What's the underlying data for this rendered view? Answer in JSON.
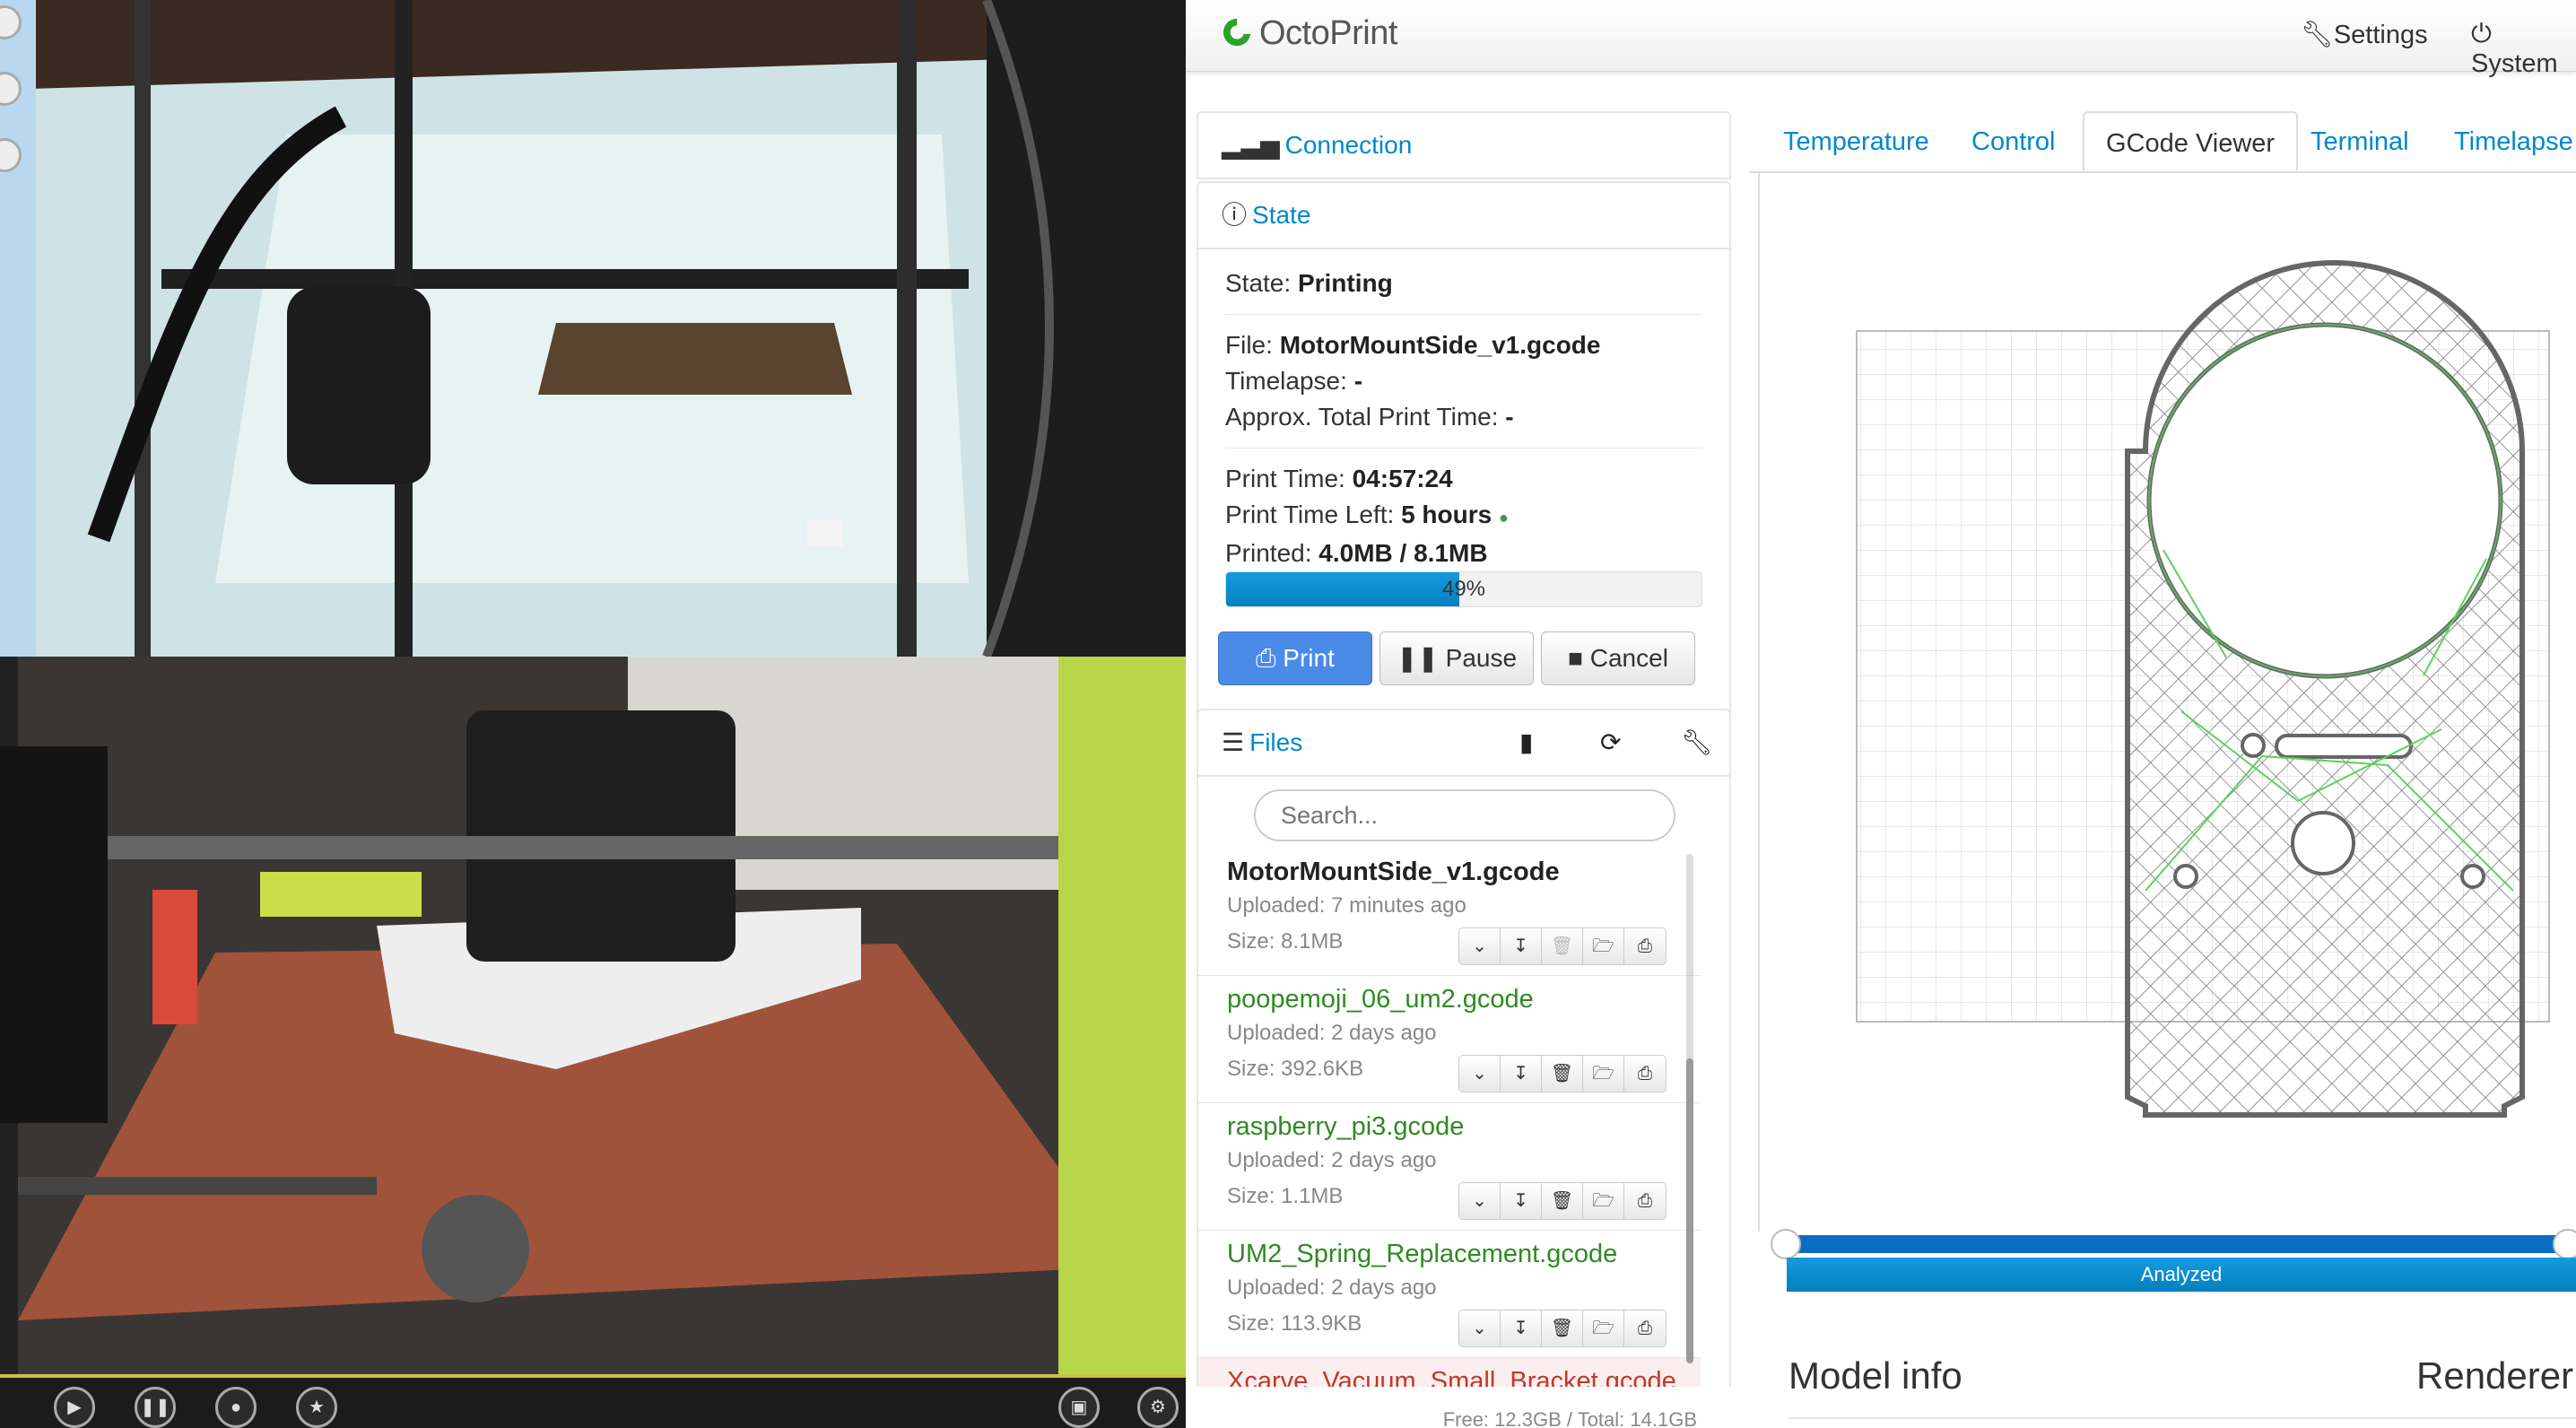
{
  "app": {
    "brand": "OctoPrint"
  },
  "navbar": {
    "settings_label": "Settings",
    "system_label": "System"
  },
  "sidebar": {
    "connection_label": "Connection",
    "state_label": "State",
    "state": {
      "state_label": "State:",
      "state_value": "Printing",
      "file_label": "File:",
      "file_value": "MotorMountSide_v1.gcode",
      "timelapse_label": "Timelapse:",
      "timelapse_value": "-",
      "approx_label": "Approx. Total Print Time:",
      "approx_value": "-",
      "print_time_label": "Print Time:",
      "print_time_value": "04:57:24",
      "time_left_label": "Print Time Left:",
      "time_left_value": "5 hours",
      "printed_label": "Printed:",
      "printed_value": "4.0MB / 8.1MB",
      "progress_percent": 49,
      "progress_label": "49%"
    },
    "buttons": {
      "print": "Print",
      "pause": "Pause",
      "cancel": "Cancel"
    },
    "files_label": "Files",
    "search_placeholder": "Search...",
    "files": [
      {
        "name": "MotorMountSide_v1.gcode",
        "uploaded": "Uploaded: 7 minutes ago",
        "size": "Size: 8.1MB"
      },
      {
        "name": "poopemoji_06_um2.gcode",
        "uploaded": "Uploaded: 2 days ago",
        "size": "Size: 392.6KB"
      },
      {
        "name": "raspberry_pi3.gcode",
        "uploaded": "Uploaded: 2 days ago",
        "size": "Size: 1.1MB"
      },
      {
        "name": "UM2_Spring_Replacement.gcode",
        "uploaded": "Uploaded: 2 days ago",
        "size": "Size: 113.9KB"
      },
      {
        "name": "Xcarve_Vacuum_Small_Bracket.gcode"
      }
    ],
    "storage": "Free: 12.3GB / Total: 14.1GB"
  },
  "tabs": [
    "Temperature",
    "Control",
    "GCode Viewer",
    "Terminal",
    "Timelapse"
  ],
  "active_tab": "GCode Viewer",
  "viewer": {
    "status_label": "Analyzed"
  },
  "sections": {
    "model_info": "Model info",
    "renderer": "Renderer"
  },
  "colors": {
    "link": "#0088cc",
    "primary": "#4a8be8",
    "progress": "#0480be",
    "file_ok": "#2f8a23"
  }
}
